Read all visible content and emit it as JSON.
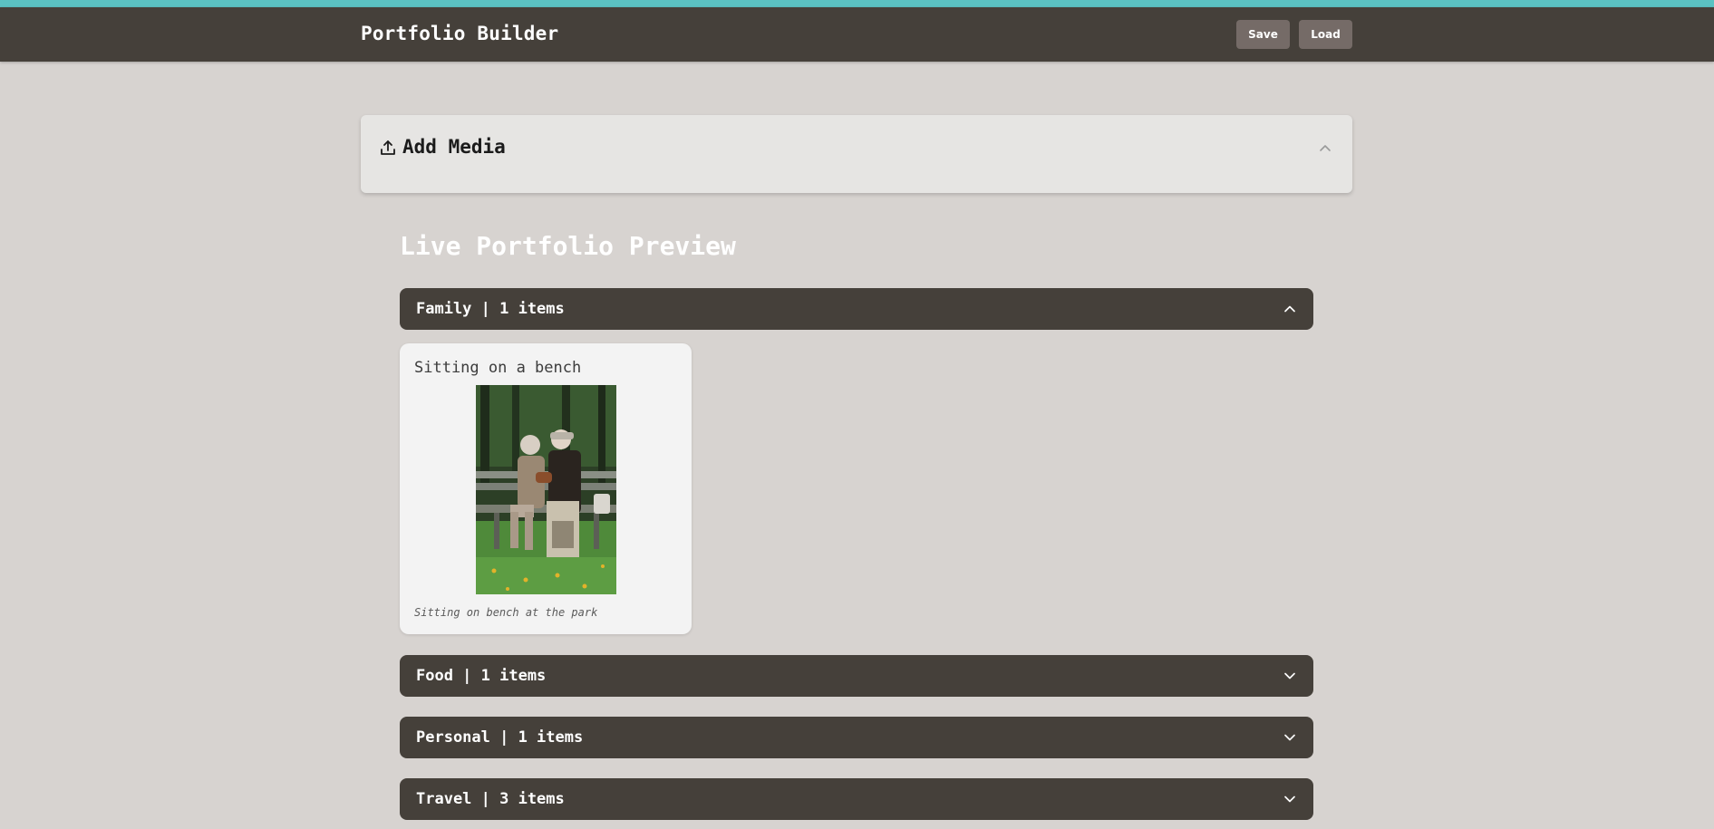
{
  "app": {
    "title": "Portfolio Builder",
    "save_label": "Save",
    "load_label": "Load"
  },
  "add_media": {
    "label": "Add Media",
    "icon": "upload-icon",
    "state": "collapsed"
  },
  "preview": {
    "title": "Live Portfolio Preview",
    "categories": [
      {
        "label": "Family | 1 items",
        "expanded": true,
        "items": [
          {
            "title": "Sitting on a bench",
            "caption": "Sitting on bench at the park"
          }
        ]
      },
      {
        "label": "Food | 1 items",
        "expanded": false
      },
      {
        "label": "Personal | 1 items",
        "expanded": false
      },
      {
        "label": "Travel | 3 items",
        "expanded": false
      }
    ]
  },
  "colors": {
    "accent_stripe": "#5bc2c2",
    "appbar": "#45403a",
    "background": "#d7d3d0",
    "button": "#756b67",
    "panel": "#e6e5e3",
    "card": "#f3f3f3"
  }
}
